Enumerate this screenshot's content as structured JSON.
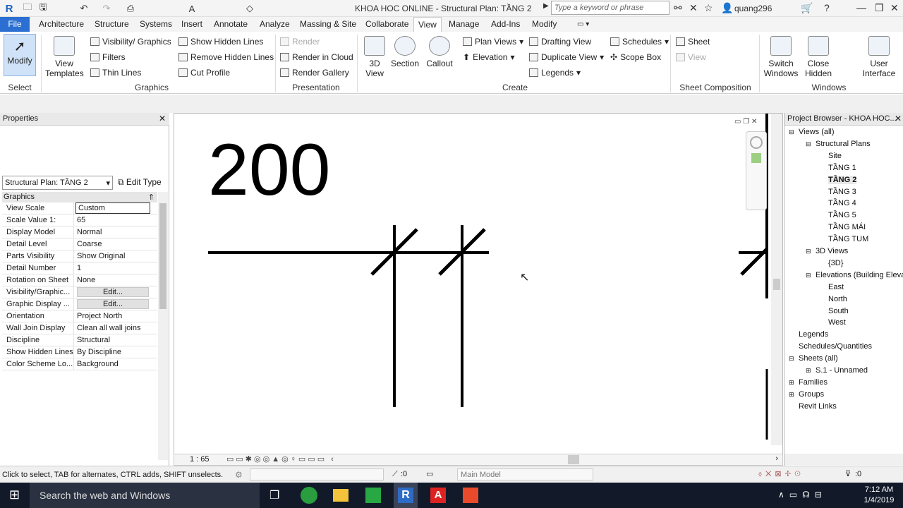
{
  "titlebar": {
    "title": "KHOA HOC ONLINE - Structural Plan: TẦNG 2",
    "search_placeholder": "Type a keyword or phrase",
    "user": "quang296"
  },
  "tabs": [
    "File",
    "Architecture",
    "Structure",
    "Systems",
    "Insert",
    "Annotate",
    "Analyze",
    "Massing & Site",
    "Collaborate",
    "View",
    "Manage",
    "Add-Ins",
    "Modify"
  ],
  "active_tab": "View",
  "ribbon": {
    "select": {
      "modify": "Modify",
      "select": "Select"
    },
    "graphics": {
      "view_templates": "View Templates",
      "vis_graphics": "Visibility/ Graphics",
      "filters": "Filters",
      "thin_lines": "Thin Lines",
      "show_hidden": "Show Hidden Lines",
      "remove_hidden": "Remove Hidden Lines",
      "cut_profile": "Cut Profile",
      "label": "Graphics"
    },
    "presentation": {
      "render": "Render",
      "render_cloud": "Render in Cloud",
      "render_gallery": "Render Gallery",
      "label": "Presentation"
    },
    "create": {
      "view3d": "3D View",
      "section": "Section",
      "callout": "Callout",
      "plan_views": "Plan Views",
      "elevation": "Elevation",
      "drafting_view": "Drafting View",
      "duplicate_view": "Duplicate View",
      "legends": "Legends",
      "schedules": "Schedules",
      "scope_box": "Scope Box",
      "label": "Create"
    },
    "sheet_comp": {
      "sheet": "Sheet",
      "view": "View",
      "label": "Sheet Composition"
    },
    "windows": {
      "switch": "Switch Windows",
      "close_hidden": "Close Hidden",
      "user_interface": "User Interface",
      "label": "Windows"
    }
  },
  "properties": {
    "title": "Properties",
    "type": "Structural Plan: TẦNG 2",
    "edit_type": "Edit Type",
    "group": "Graphics",
    "rows": [
      {
        "k": "View Scale",
        "v": "Custom"
      },
      {
        "k": "Scale Value    1:",
        "v": "65"
      },
      {
        "k": "Display Model",
        "v": "Normal"
      },
      {
        "k": "Detail Level",
        "v": "Coarse"
      },
      {
        "k": "Parts Visibility",
        "v": "Show Original"
      },
      {
        "k": "Detail Number",
        "v": "1"
      },
      {
        "k": "Rotation on Sheet",
        "v": "None"
      },
      {
        "k": "Visibility/Graphic...",
        "v": "Edit..."
      },
      {
        "k": "Graphic Display ...",
        "v": "Edit..."
      },
      {
        "k": "Orientation",
        "v": "Project North"
      },
      {
        "k": "Wall Join Display",
        "v": "Clean all wall joins"
      },
      {
        "k": "Discipline",
        "v": "Structural"
      },
      {
        "k": "Show Hidden Lines",
        "v": "By Discipline"
      },
      {
        "k": "Color Scheme Lo...",
        "v": "Background"
      }
    ]
  },
  "canvas": {
    "dimension_text": "200",
    "scale": "1 : 65"
  },
  "browser": {
    "title": "Project Browser - KHOA HOC...",
    "nodes": [
      {
        "label": "Views (all)",
        "lvl": 0
      },
      {
        "label": "Structural Plans",
        "lvl": 1
      },
      {
        "label": "Site",
        "lvl": 2
      },
      {
        "label": "TẦNG 1",
        "lvl": 2
      },
      {
        "label": "TẦNG 2",
        "lvl": 2,
        "bold": true
      },
      {
        "label": "TẦNG 3",
        "lvl": 2
      },
      {
        "label": "TẦNG 4",
        "lvl": 2
      },
      {
        "label": "TẦNG 5",
        "lvl": 2
      },
      {
        "label": "TẦNG MÁI",
        "lvl": 2
      },
      {
        "label": "TẦNG TUM",
        "lvl": 2
      },
      {
        "label": "3D Views",
        "lvl": 1
      },
      {
        "label": "{3D}",
        "lvl": 2
      },
      {
        "label": "Elevations (Building Eleva",
        "lvl": 1
      },
      {
        "label": "East",
        "lvl": 2
      },
      {
        "label": "North",
        "lvl": 2
      },
      {
        "label": "South",
        "lvl": 2
      },
      {
        "label": "West",
        "lvl": 2
      },
      {
        "label": "Legends",
        "lvl": 0
      },
      {
        "label": "Schedules/Quantities",
        "lvl": 0
      },
      {
        "label": "Sheets (all)",
        "lvl": 0
      },
      {
        "label": "S.1 - Unnamed",
        "lvl": 1
      },
      {
        "label": "Families",
        "lvl": 0
      },
      {
        "label": "Groups",
        "lvl": 0
      },
      {
        "label": "Revit Links",
        "lvl": 0
      }
    ]
  },
  "status": {
    "hint": "Click to select, TAB for alternates, CTRL adds, SHIFT unselects.",
    "zero1": ":0",
    "model": "Main Model",
    "zero2": ":0"
  },
  "taskbar": {
    "search": "Search the web and Windows",
    "time": "7:12 AM",
    "date": "1/4/2019"
  }
}
